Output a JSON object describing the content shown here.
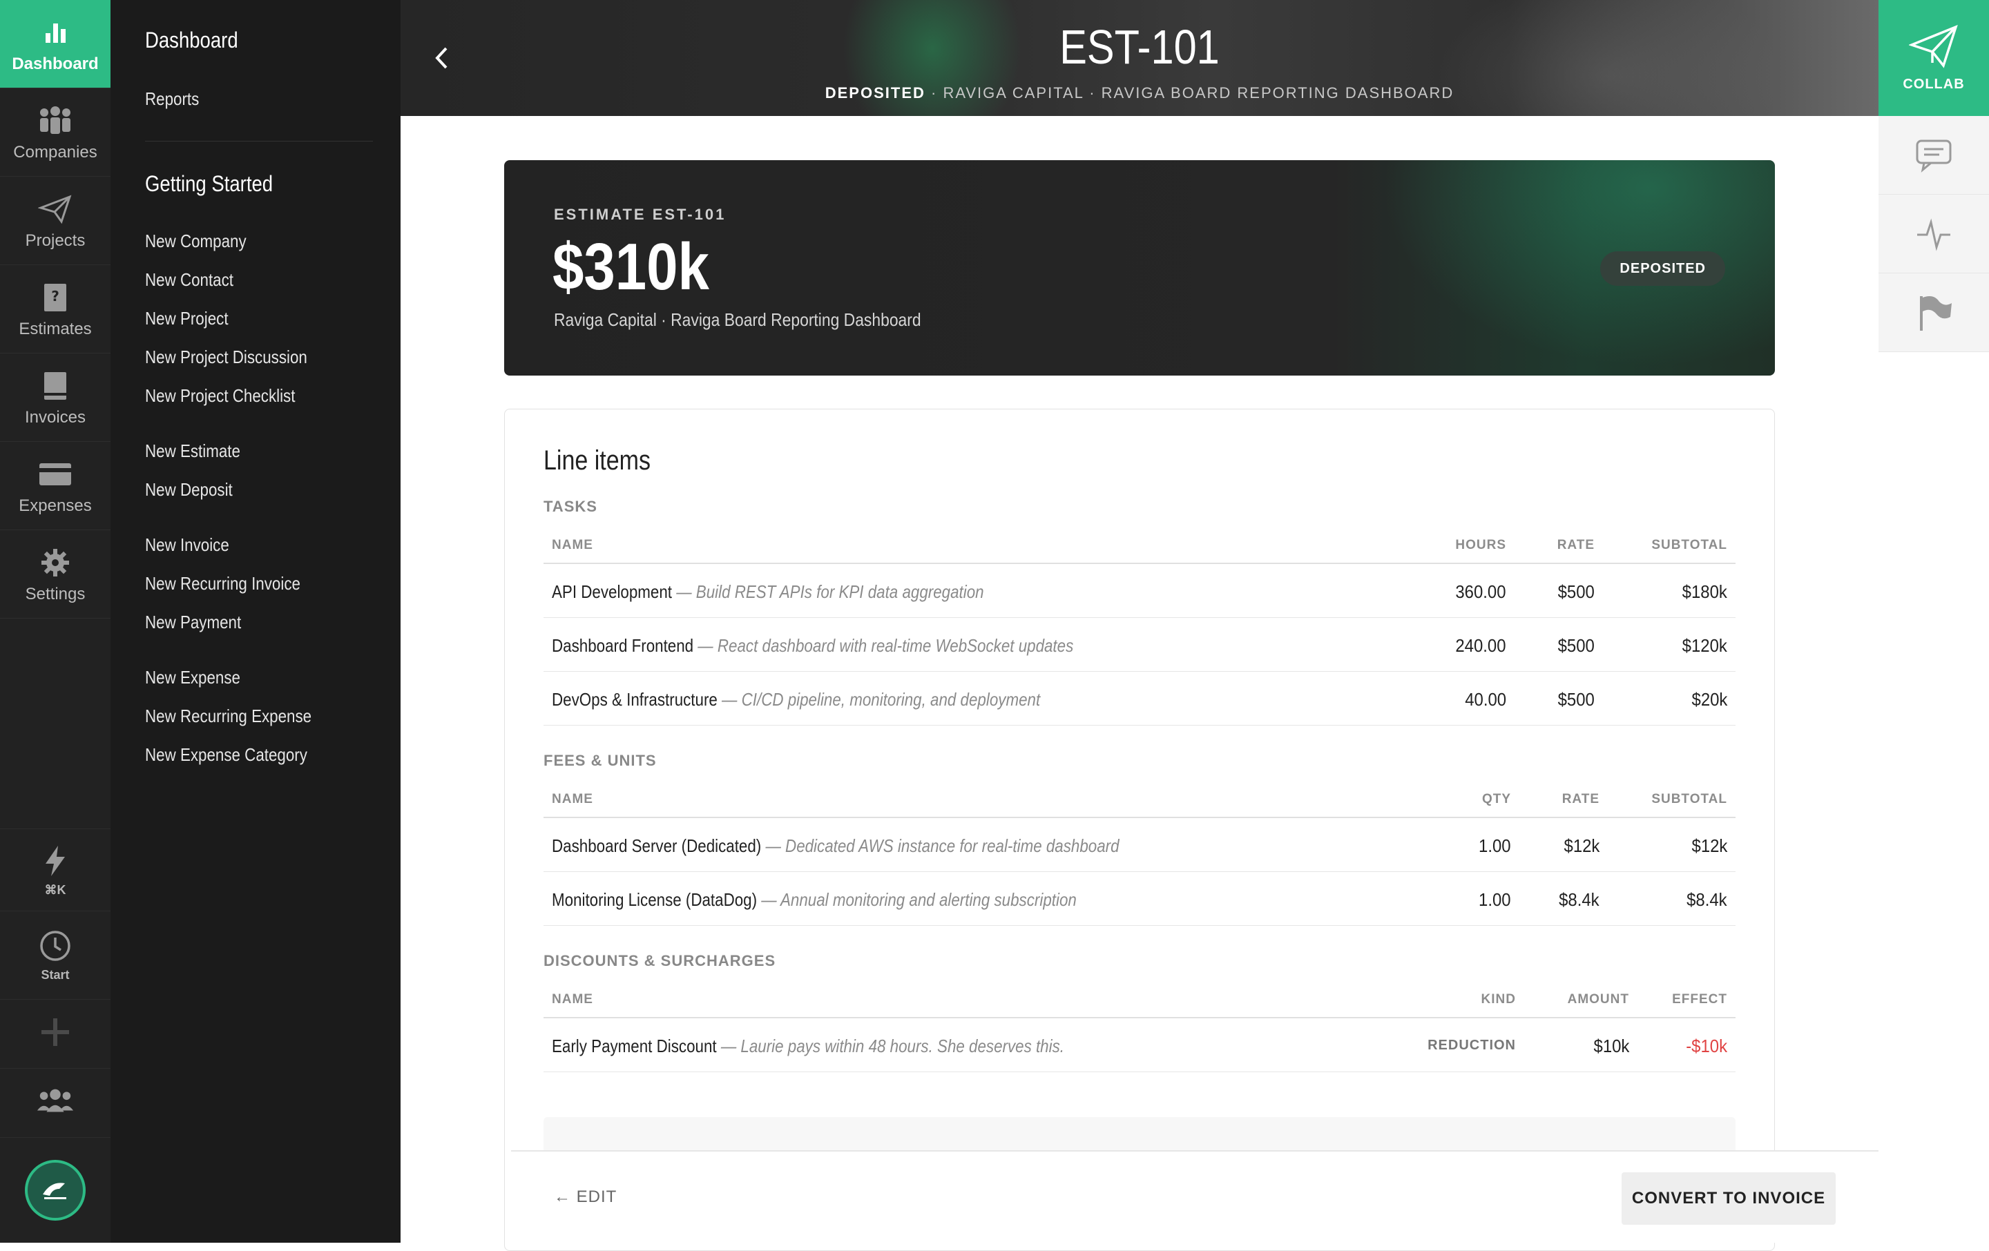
{
  "rail": {
    "items": [
      {
        "label": "Dashboard",
        "icon": "bar-chart-icon"
      },
      {
        "label": "Companies",
        "icon": "people-icon"
      },
      {
        "label": "Projects",
        "icon": "paper-plane-icon"
      },
      {
        "label": "Estimates",
        "icon": "question-doc-icon"
      },
      {
        "label": "Invoices",
        "icon": "invoice-icon"
      },
      {
        "label": "Expenses",
        "icon": "credit-card-icon"
      },
      {
        "label": "Settings",
        "icon": "gear-icon"
      }
    ],
    "quick": {
      "label": "⌘K",
      "icon": "lightning-icon"
    },
    "timer": {
      "label": "Start",
      "icon": "clock-icon"
    },
    "add": {
      "icon": "plus-icon"
    },
    "team": {
      "icon": "team-icon"
    },
    "avatar": {
      "icon": "logo-avatar"
    }
  },
  "subnav": {
    "dashboard": "Dashboard",
    "reports": "Reports",
    "getting_started": "Getting Started",
    "links": [
      "New Company",
      "New Contact",
      "New Project",
      "New Project Discussion",
      "New Project Checklist",
      "New Estimate",
      "New Deposit",
      "New Invoice",
      "New Recurring Invoice",
      "New Payment",
      "New Expense",
      "New Recurring Expense",
      "New Expense Category"
    ]
  },
  "header": {
    "title": "EST-101",
    "status": "DEPOSITED",
    "sub": " · RAVIGA CAPITAL · RAVIGA BOARD REPORTING DASHBOARD"
  },
  "right_rail": {
    "collab": "COLLAB"
  },
  "hero": {
    "label": "ESTIMATE EST-101",
    "amount": "$310k",
    "desc": "Raviga Capital · Raviga Board Reporting Dashboard",
    "badge": "DEPOSITED"
  },
  "line_items": {
    "title": "Line items",
    "tasks": {
      "title": "TASKS",
      "headers": [
        "NAME",
        "HOURS",
        "RATE",
        "SUBTOTAL"
      ],
      "rows": [
        {
          "name": "API Development",
          "desc": " — Build REST APIs for KPI data aggregation",
          "hours": "360.00",
          "rate": "$500",
          "subtotal": "$180k"
        },
        {
          "name": "Dashboard Frontend",
          "desc": " — React dashboard with real-time WebSocket updates",
          "hours": "240.00",
          "rate": "$500",
          "subtotal": "$120k"
        },
        {
          "name": "DevOps & Infrastructure",
          "desc": " — CI/CD pipeline, monitoring, and deployment",
          "hours": "40.00",
          "rate": "$500",
          "subtotal": "$20k"
        }
      ]
    },
    "fees": {
      "title": "FEES & UNITS",
      "headers": [
        "NAME",
        "QTY",
        "RATE",
        "SUBTOTAL"
      ],
      "rows": [
        {
          "name": "Dashboard Server (Dedicated)",
          "desc": " — Dedicated AWS instance for real-time dashboard",
          "qty": "1.00",
          "rate": "$12k",
          "subtotal": "$12k"
        },
        {
          "name": "Monitoring License (DataDog)",
          "desc": " — Annual monitoring and alerting subscription",
          "qty": "1.00",
          "rate": "$8.4k",
          "subtotal": "$8.4k"
        }
      ]
    },
    "discounts": {
      "title": "DISCOUNTS & SURCHARGES",
      "headers": [
        "NAME",
        "KIND",
        "AMOUNT",
        "EFFECT"
      ],
      "rows": [
        {
          "name": "Early Payment Discount",
          "desc": " — Laurie pays within 48 hours. She deserves this.",
          "kind": "REDUCTION",
          "amount": "$10k",
          "effect": "-$10k"
        }
      ]
    }
  },
  "footer": {
    "edit": "← EDIT",
    "convert": "CONVERT TO INVOICE"
  },
  "colors": {
    "accent": "#2dbb85",
    "negative": "#e04343",
    "rail": "#222222",
    "subnav": "#1b1b1b"
  }
}
